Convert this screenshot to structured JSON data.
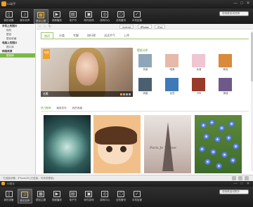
{
  "window": {
    "title": "91助手",
    "controls": [
      "—",
      "□",
      "✕"
    ]
  },
  "toolbar": {
    "items": [
      {
        "label": "我的设备",
        "icon": "phone-icon",
        "glyph": "▯"
      },
      {
        "label": "音乐铃声",
        "icon": "music-icon",
        "glyph": "♫"
      },
      {
        "label": "壁纸主题",
        "icon": "wallpaper-icon",
        "glyph": "▦"
      },
      {
        "label": "视频播放",
        "icon": "video-icon",
        "glyph": "▶"
      },
      {
        "label": "电子书",
        "icon": "ebook-icon",
        "glyph": "▤"
      },
      {
        "label": "软件游戏",
        "icon": "apps-icon",
        "glyph": "▣"
      },
      {
        "label": "游戏中心",
        "icon": "gamepad-icon",
        "glyph": "◎"
      },
      {
        "label": "全机备份",
        "icon": "backup-icon",
        "glyph": "⬡"
      },
      {
        "label": "手机加速",
        "icon": "shield-icon",
        "glyph": "✓"
      }
    ],
    "active_index": 2,
    "search_placeholder": "搜索壁纸或资源"
  },
  "toolbar2": {
    "items": [
      {
        "label": "我的设备",
        "icon": "phone-icon",
        "glyph": "▯"
      },
      {
        "label": "音乐铃声",
        "icon": "music-icon",
        "glyph": "♫"
      },
      {
        "label": "壁纸主题",
        "icon": "wallpaper-icon",
        "glyph": "▦"
      },
      {
        "label": "视频播放",
        "icon": "video-icon",
        "glyph": "▶"
      },
      {
        "label": "电子书",
        "icon": "ebook-icon",
        "glyph": "▤"
      },
      {
        "label": "软件游戏",
        "icon": "apps-icon",
        "glyph": "▣"
      },
      {
        "label": "游戏中心",
        "icon": "gamepad-icon",
        "glyph": "◎"
      },
      {
        "label": "全机备份",
        "icon": "backup-icon",
        "glyph": "⬡"
      },
      {
        "label": "手机加速",
        "icon": "shield-icon",
        "glyph": "✓"
      }
    ],
    "active_index": 1,
    "search_placeholder": "搜索歌曲或歌手"
  },
  "sidebar": {
    "items": [
      {
        "label": "手机上的图片",
        "type": "group"
      },
      {
        "label": "相机",
        "type": "sub"
      },
      {
        "label": "壁纸",
        "type": "sub"
      },
      {
        "label": "壁纸收藏",
        "type": "sub"
      },
      {
        "label": "电脑上的图片",
        "type": "group"
      },
      {
        "label": "图片库",
        "type": "sub"
      },
      {
        "label": "网络资源",
        "type": "group"
      },
      {
        "label": "壁纸库",
        "type": "sub",
        "active": true
      }
    ]
  },
  "nav": {
    "device_tabs": [
      "Android",
      "iPhone",
      "iPad"
    ],
    "active_device": 1
  },
  "category_tabs": [
    "首页",
    "分类",
    "专题",
    "排行榜",
    "试试手气",
    "上传"
  ],
  "active_category_tab": 0,
  "banner": {
    "badge": "专题",
    "caption": "名模"
  },
  "categories": {
    "title": "壁纸分类",
    "items": [
      {
        "name": "风景",
        "color": "#8fa6b8"
      },
      {
        "name": "唯美",
        "color": "#e7b9a8"
      },
      {
        "name": "动漫",
        "color": "#f0c6d2"
      },
      {
        "name": "萌宠",
        "color": "#d98a3a"
      },
      {
        "name": "明星",
        "color": "#4a6070"
      },
      {
        "name": "创意",
        "color": "#3f7ab8"
      },
      {
        "name": "汽车",
        "color": "#9a3a2a"
      },
      {
        "name": "情感",
        "color": "#6e5a8a"
      }
    ]
  },
  "sub_tabs": [
    "热门推荐",
    "最新发布",
    "我的收藏"
  ],
  "active_sub_tab": 0,
  "wallpaper_text": "Paris Je T'aime",
  "status": {
    "text": "已连接设备：iPhone4S (已连接，可浏览壁纸)"
  }
}
